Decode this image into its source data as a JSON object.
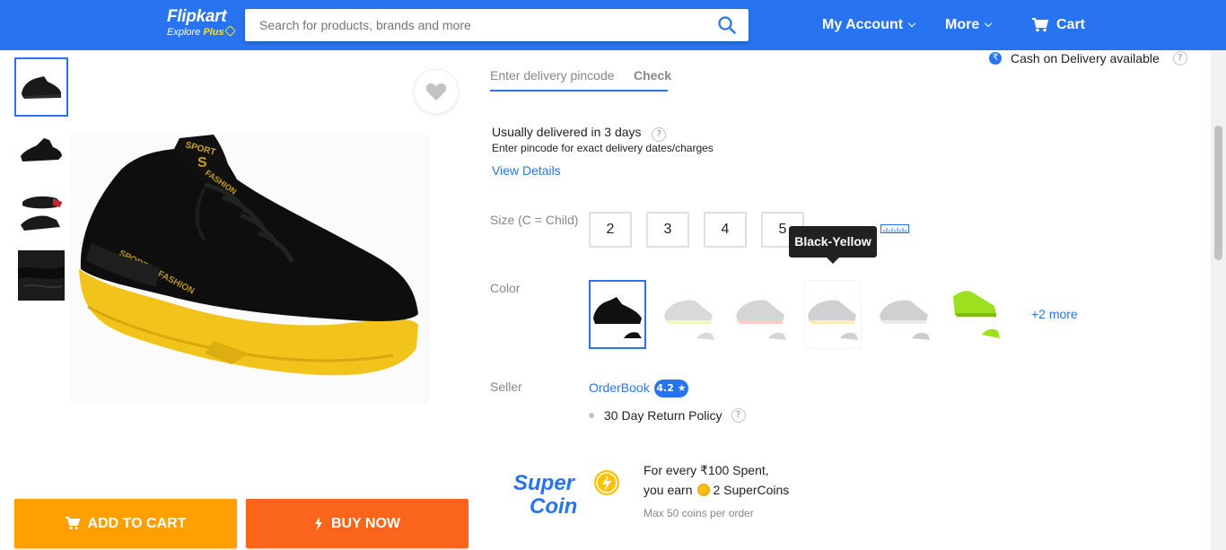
{
  "header": {
    "logo_main": "Flipkart",
    "logo_sub": "Explore",
    "logo_plus": "Plus",
    "search_placeholder": "Search for products, brands and more",
    "account_label": "My Account",
    "more_label": "More",
    "cart_label": "Cart"
  },
  "colors": {
    "brand_blue": "#2874f0",
    "add_to_cart": "#ff9f00",
    "buy_now": "#fb641b"
  },
  "actions": {
    "add_to_cart": "ADD TO CART",
    "buy_now": "BUY NOW"
  },
  "delivery": {
    "pincode_placeholder": "Enter delivery pincode",
    "check_label": "Check",
    "cod_text": "Cash on Delivery available",
    "usually_delivered": "Usually delivered in 3 days",
    "pincode_hint": "Enter pincode for exact delivery dates/charges",
    "view_details": "View Details"
  },
  "size": {
    "label": "Size (C = Child)",
    "options": [
      "2",
      "3",
      "4",
      "5"
    ]
  },
  "color": {
    "label": "Color",
    "tooltip": "Black-Yellow",
    "more": "+2 more"
  },
  "seller": {
    "label": "Seller",
    "name": "OrderBook",
    "rating": "4.2 ★",
    "return_policy": "30 Day Return Policy"
  },
  "supercoin": {
    "line1": "For every ₹100 Spent,",
    "line2_prefix": "you earn",
    "line2_suffix": "2 SuperCoins",
    "line3": "Max 50 coins per order"
  }
}
